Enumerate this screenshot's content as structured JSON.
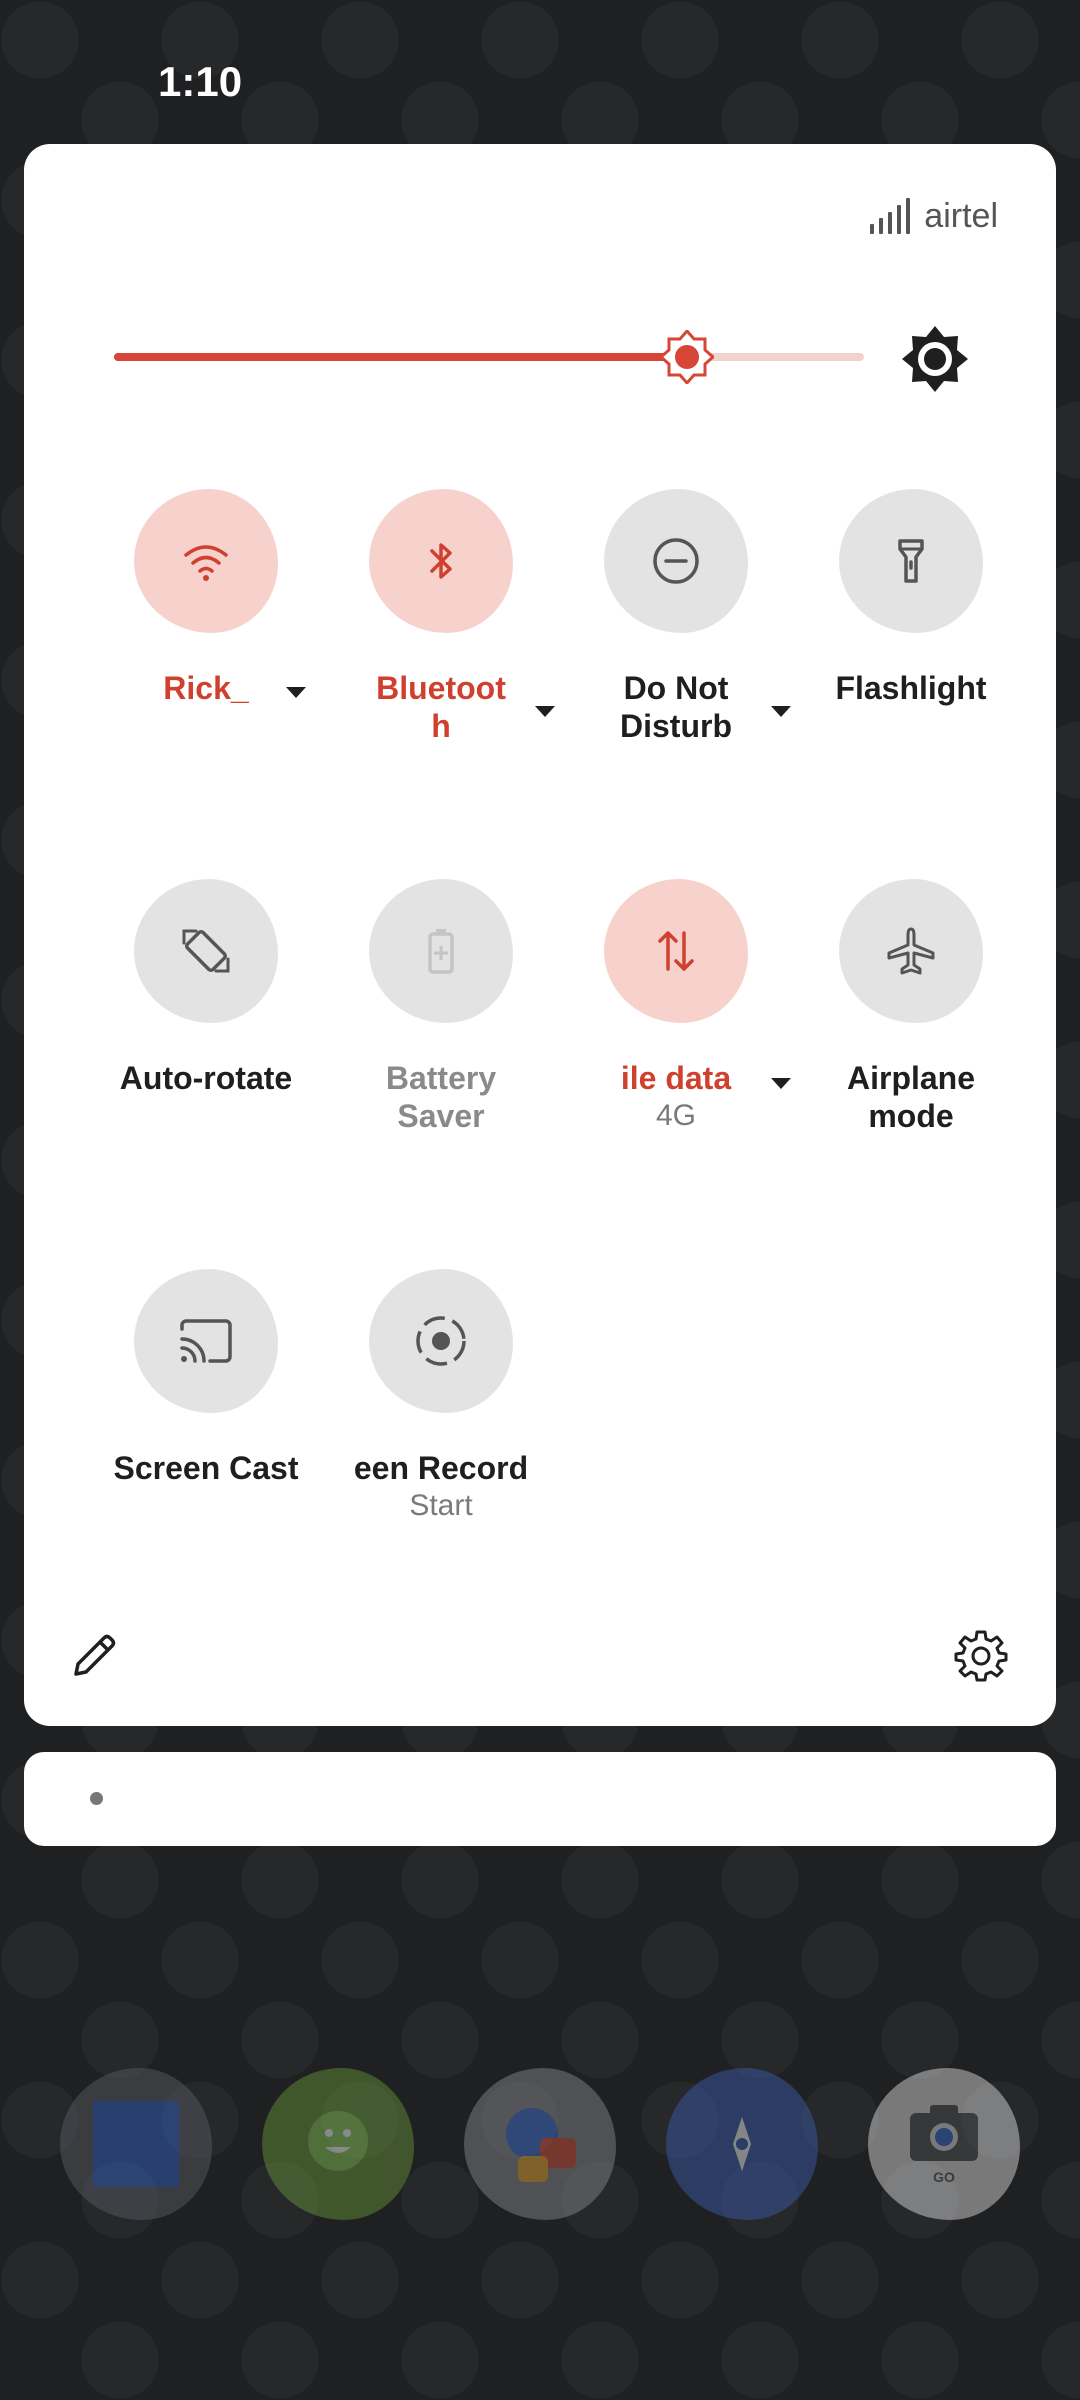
{
  "status_bar": {
    "time": "1:10"
  },
  "carrier": {
    "name": "airtel"
  },
  "brightness": {
    "level_percent": 76
  },
  "tiles": [
    {
      "id": "wifi",
      "label": "Rick_",
      "active": true,
      "has_menu": true
    },
    {
      "id": "bluetooth",
      "label": "Bluetoot\nh",
      "active": true,
      "has_menu": true
    },
    {
      "id": "dnd",
      "label": "Do Not\nDisturb",
      "active": false,
      "has_menu": true
    },
    {
      "id": "flashlight",
      "label": "Flashlight",
      "active": false,
      "has_menu": false
    },
    {
      "id": "autorotate",
      "label": "Auto-rotate",
      "active": false,
      "has_menu": false
    },
    {
      "id": "battery-saver",
      "label": "Battery\nSaver",
      "active": false,
      "disabled": true
    },
    {
      "id": "mobile-data",
      "label": "ile data",
      "subtitle": "4G",
      "active": true,
      "has_menu": true
    },
    {
      "id": "airplane",
      "label": "Airplane\nmode",
      "active": false,
      "has_menu": false
    },
    {
      "id": "screen-cast",
      "label": "Screen Cast",
      "active": false
    },
    {
      "id": "screen-record",
      "label": "een Record",
      "subtitle": "Start",
      "active": false
    }
  ],
  "colors": {
    "accent": "#d0402f",
    "tile_on": "#f7d2cd",
    "tile_off": "#e3e3e3",
    "panel": "#ffffff",
    "wallpaper": "#1f2022"
  },
  "icons": {
    "wifi": "wifi-icon",
    "bluetooth": "bluetooth-icon",
    "dnd": "do-not-disturb-icon",
    "flashlight": "flashlight-icon",
    "autorotate": "auto-rotate-icon",
    "battery": "battery-saver-icon",
    "mobile_data": "mobile-data-icon",
    "airplane": "airplane-icon",
    "cast": "screen-cast-icon",
    "record": "screen-record-icon",
    "edit": "edit-pencil-icon",
    "settings": "settings-gear-icon",
    "brightness": "brightness-icon"
  },
  "dock": {
    "apps": [
      "blue-square-app-icon",
      "messages-app-icon",
      "duo-app-icon",
      "maps-go-app-icon",
      "camera-go-app-icon"
    ],
    "camera_badge": "GO"
  }
}
